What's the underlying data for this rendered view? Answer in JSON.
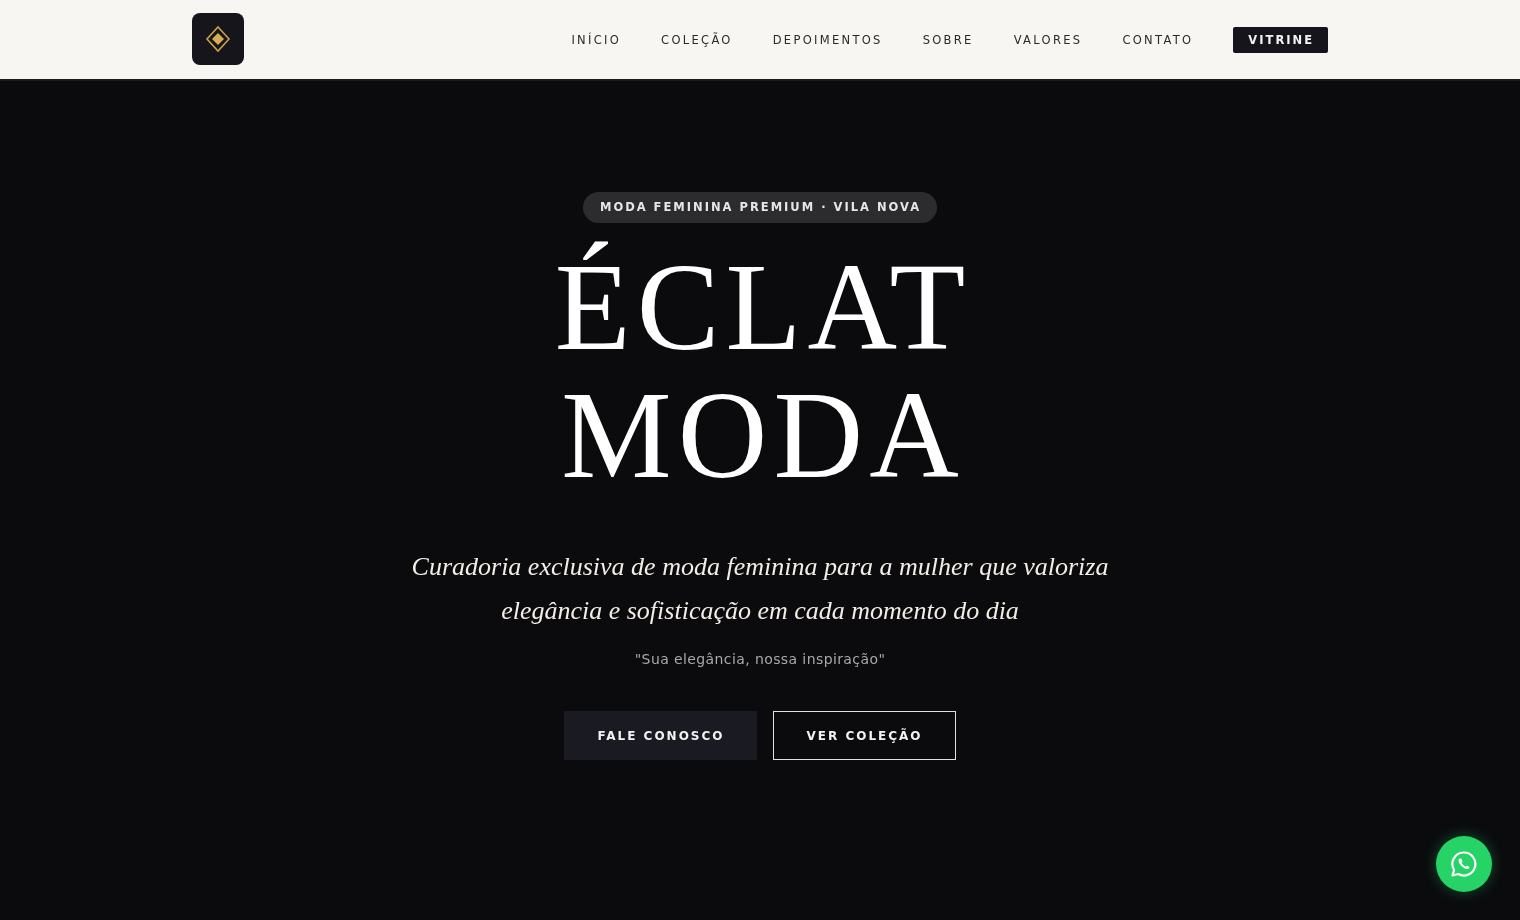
{
  "header": {
    "nav": [
      {
        "label": "INÍCIO"
      },
      {
        "label": "COLEÇÃO"
      },
      {
        "label": "DEPOIMENTOS"
      },
      {
        "label": "SOBRE"
      },
      {
        "label": "VALORES"
      },
      {
        "label": "CONTATO"
      }
    ],
    "cta": "VITRINE"
  },
  "hero": {
    "badge": "MODA FEMININA PREMIUM · VILA NOVA",
    "title_lines": [
      "ÉCLAT",
      "MODA"
    ],
    "subtitle": "Curadoria exclusiva de moda feminina para a mulher que valoriza elegância e sofisticação em cada momento do dia",
    "quote": "\"Sua elegância, nossa inspiração\"",
    "buttons": [
      {
        "label": "FALE CONOSCO",
        "kind": "filled"
      },
      {
        "label": "VER COLEÇÃO",
        "kind": "outline"
      }
    ]
  }
}
